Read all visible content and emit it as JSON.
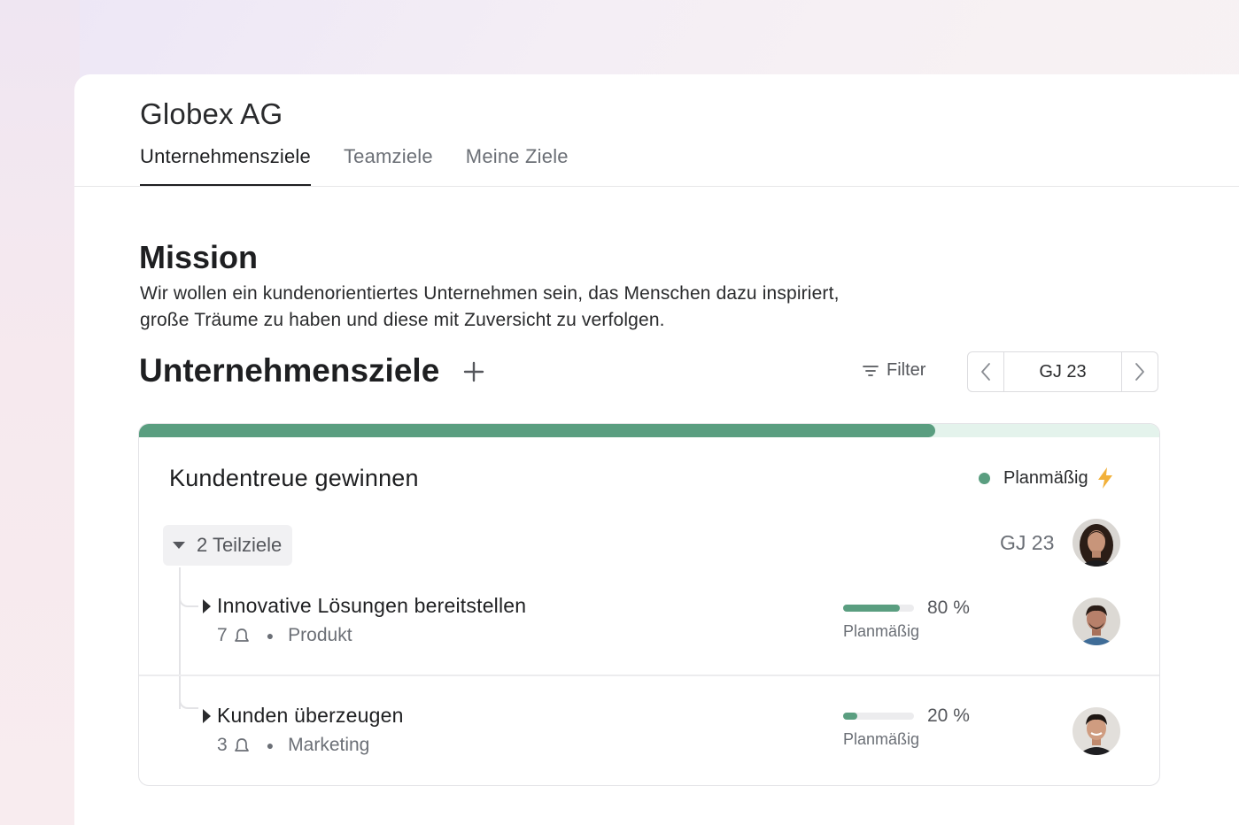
{
  "company": {
    "name": "Globex AG"
  },
  "tabs": [
    {
      "label": "Unternehmensziele",
      "active": true
    },
    {
      "label": "Teamziele",
      "active": false
    },
    {
      "label": "Meine Ziele",
      "active": false
    }
  ],
  "mission": {
    "title": "Mission",
    "text_line1": "Wir wollen ein kundenorientiertes Unternehmen sein, das Menschen dazu inspiriert,",
    "text_line2": "große Träume zu haben und diese mit Zuversicht zu verfolgen."
  },
  "goals_section": {
    "title": "Unternehmensziele",
    "add_icon": "plus-icon",
    "filter_label": "Filter",
    "filter_icon": "filter-icon",
    "period_label": "GJ 23",
    "prev_icon": "chevron-left-icon",
    "next_icon": "chevron-right-icon"
  },
  "goal": {
    "title": "Kundentreue gewinnen",
    "progress": 0.78,
    "status": "Planmäßig",
    "status_color": "#5a9e80",
    "status_icon": "lightning-icon",
    "subgoals_label": "2 Teilziele",
    "period": "GJ 23",
    "owner_avatar": "avatar-woman",
    "subgoals": [
      {
        "title": "Innovative Lösungen bereitstellen",
        "count": "7",
        "team": "Produkt",
        "progress": 80,
        "progress_label": "80 %",
        "status": "Planmäßig",
        "avatar": "avatar-man-1"
      },
      {
        "title": "Kunden überzeugen",
        "count": "3",
        "team": "Marketing",
        "progress": 20,
        "progress_label": "20 %",
        "status": "Planmäßig",
        "avatar": "avatar-man-2"
      }
    ]
  },
  "colors": {
    "accent_green": "#5a9e80",
    "track_green": "#e4f3ec",
    "lightning": "#f2b13a"
  }
}
